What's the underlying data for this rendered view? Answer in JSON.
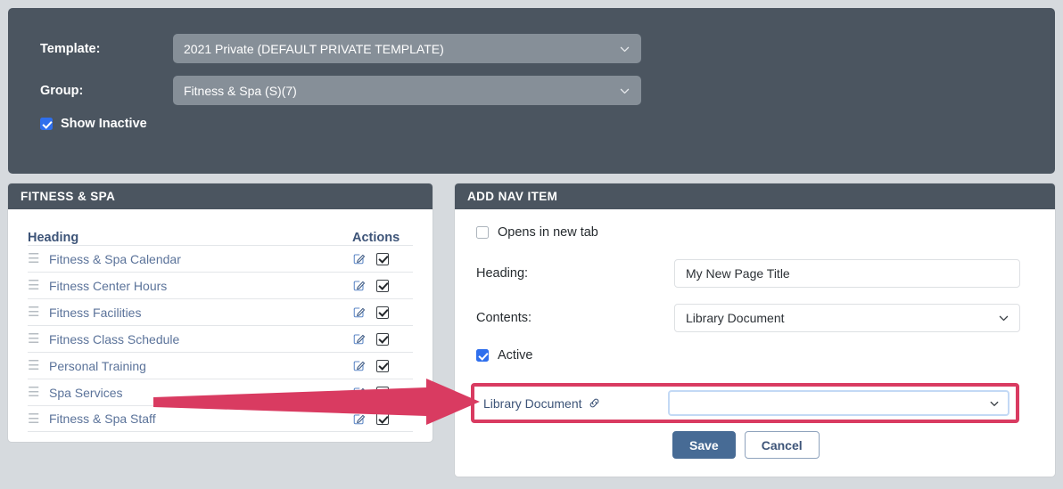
{
  "filters": {
    "template_label": "Template:",
    "template_value": "2021 Private (DEFAULT PRIVATE TEMPLATE)",
    "group_label": "Group:",
    "group_value": "Fitness & Spa (S)(7)",
    "show_inactive_label": "Show Inactive",
    "show_inactive_checked": true
  },
  "left_panel": {
    "title": "FITNESS & SPA",
    "columns": {
      "heading": "Heading",
      "actions": "Actions"
    },
    "rows": [
      {
        "title": "Fitness & Spa Calendar",
        "active": true
      },
      {
        "title": "Fitness Center Hours",
        "active": true
      },
      {
        "title": "Fitness Facilities",
        "active": true
      },
      {
        "title": "Fitness Class Schedule",
        "active": true
      },
      {
        "title": "Personal Training",
        "active": true
      },
      {
        "title": "Spa Services",
        "active": true
      },
      {
        "title": "Fitness & Spa Staff",
        "active": true
      }
    ]
  },
  "right_panel": {
    "title": "ADD NAV ITEM",
    "opens_in_new_tab_label": "Opens in new tab",
    "opens_in_new_tab_checked": false,
    "heading_label": "Heading:",
    "heading_value": "My New Page Title",
    "contents_label": "Contents:",
    "contents_value": "Library Document",
    "active_label": "Active",
    "active_checked": true,
    "library_document_label": "Library Document",
    "library_document_value": "",
    "save_label": "Save",
    "cancel_label": "Cancel"
  },
  "colors": {
    "panel_dark": "#4b5560",
    "accent_blue": "#2f6fed",
    "link_blue": "#5b739a",
    "annotation_pink": "#d93b61",
    "button_primary": "#476b95"
  }
}
